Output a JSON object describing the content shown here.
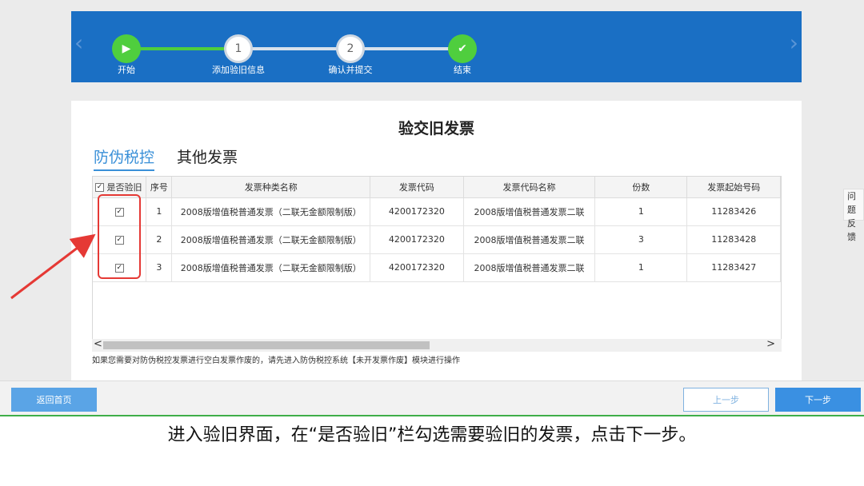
{
  "stepper": {
    "steps": [
      {
        "label": "开始",
        "symbol": "▶"
      },
      {
        "label": "添加验旧信息",
        "symbol": "1"
      },
      {
        "label": "确认并提交",
        "symbol": "2"
      },
      {
        "label": "结束",
        "symbol": "✔"
      }
    ],
    "left_arrow": "‹",
    "right_arrow": "›"
  },
  "panel": {
    "title": "验交旧发票",
    "tabs": [
      {
        "label": "防伪税控",
        "active": true
      },
      {
        "label": "其他发票",
        "active": false
      }
    ]
  },
  "table": {
    "headers": [
      "是否验旧",
      "序号",
      "发票种类名称",
      "发票代码",
      "发票代码名称",
      "份数",
      "发票起始号码"
    ],
    "rows": [
      {
        "checked": "✓",
        "index": "1",
        "type_name": "2008版增值税普通发票（二联无金额限制版）",
        "code": "4200172320",
        "code_name": "2008版增值税普通发票二联",
        "count": "1",
        "start_no": "11283426"
      },
      {
        "checked": "✓",
        "index": "2",
        "type_name": "2008版增值税普通发票（二联无金额限制版）",
        "code": "4200172320",
        "code_name": "2008版增值税普通发票二联",
        "count": "3",
        "start_no": "11283428"
      },
      {
        "checked": "✓",
        "index": "3",
        "type_name": "2008版增值税普通发票（二联无金额限制版）",
        "code": "4200172320",
        "code_name": "2008版增值税普通发票二联",
        "count": "1",
        "start_no": "11283427"
      }
    ],
    "header_check": "✓"
  },
  "note": "如果您需要对防伪税控发票进行空白发票作废的，请先进入防伪税控系统【未开发票作废】模块进行操作",
  "side_tab": {
    "line1": "问题",
    "line2": "反馈"
  },
  "buttons": {
    "home": "返回首页",
    "prev": "上一步",
    "next": "下一步"
  },
  "caption": "进入验旧界面，在“是否验旧”栏勾选需要验旧的发票，点击下一步。",
  "colors": {
    "banner": "#1a6fc4",
    "step_done": "#4fce3e",
    "highlight": "#e53935",
    "accent": "#3a90e2"
  }
}
